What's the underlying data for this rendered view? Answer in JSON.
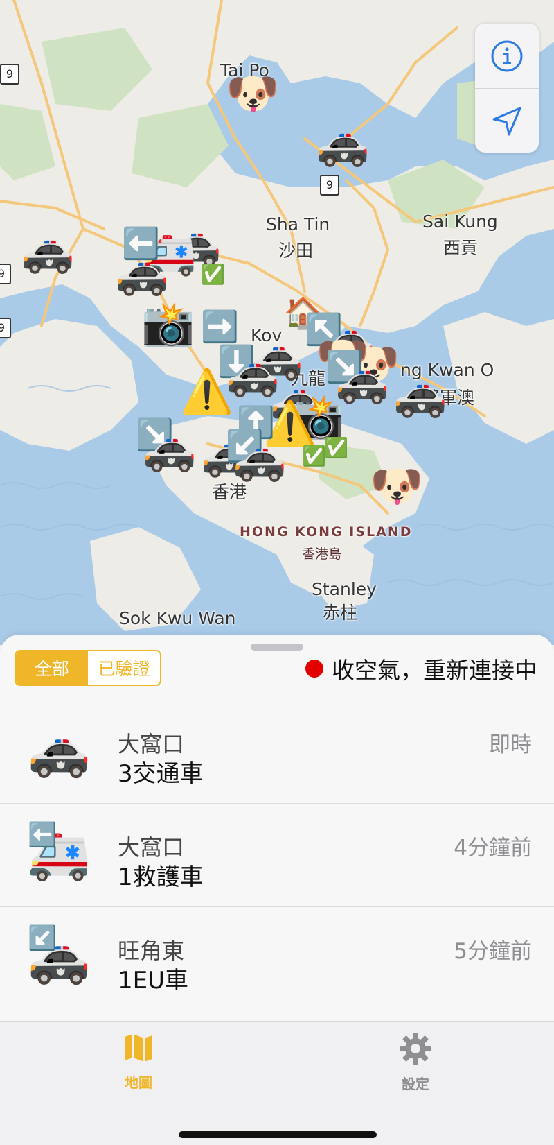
{
  "map": {
    "labels": {
      "tai_po": "Tai Po",
      "sha_tin": "Sha Tin",
      "sha_tin_zh": "沙田",
      "sai_kung": "Sai Kung",
      "sai_kung_zh": "西貢",
      "kowloon_partial": "Kov",
      "kowloon_zh_partial": "九龍",
      "tko_partial": "ng Kwan O",
      "tko_zh_partial": "將軍澳",
      "hk_island": "HONG KONG ISLAND",
      "hk_island_zh": "香港島",
      "stanley": "Stanley",
      "stanley_zh": "赤柱",
      "sok_kwu_wan": "Sok Kwu Wan",
      "hong_kong_zh_partial": "香港"
    },
    "route_shields": [
      "9",
      "9",
      "9",
      "9"
    ],
    "markers": {
      "police_car": "🚓",
      "ambulance": "🚑",
      "dog": "🐶",
      "camera": "📸",
      "warning": "⚠️",
      "check": "✅",
      "house": "🏠",
      "arrow_left": "⬅️",
      "arrow_right": "➡️",
      "arrow_down": "⬇️",
      "arrow_up": "⬆️",
      "arrow_up_left": "↖️",
      "arrow_down_right": "↘️",
      "arrow_down_left": "↙️"
    }
  },
  "controls": {
    "info_icon": "info-icon",
    "locate_icon": "location-arrow-icon"
  },
  "sheet": {
    "segments": [
      "全部",
      "已驗證"
    ],
    "active_segment": 0,
    "status_text": "收空氣，重新連接中",
    "status_color": "#e30000"
  },
  "list": [
    {
      "icon": "🚓",
      "badge": "",
      "location": "大窩口",
      "title": "3交通車",
      "time": "即時"
    },
    {
      "icon": "🚑",
      "badge": "⬅️",
      "location": "大窩口",
      "title": "1救護車",
      "time": "4分鐘前"
    },
    {
      "icon": "🚓",
      "badge": "↙️",
      "location": "旺角東",
      "title": "1EU車",
      "time": "5分鐘前"
    }
  ],
  "tabs": [
    {
      "label": "地圖",
      "icon": "map-icon",
      "active": true
    },
    {
      "label": "設定",
      "icon": "gear-icon",
      "active": false
    }
  ],
  "colors": {
    "accent": "#f0b62a",
    "inactive": "#8e8e93",
    "water": "#a9cbe8",
    "land": "#eeece6"
  }
}
